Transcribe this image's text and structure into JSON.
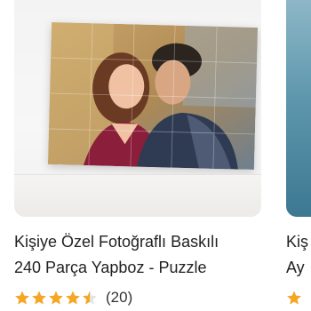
{
  "product": {
    "title_line1": "Kişiye Özel Fotoğraflı Baskılı",
    "title_line2": "240 Parça Yapboz - Puzzle",
    "rating_value": 4.5,
    "rating_max": 5,
    "review_count": "(20)"
  },
  "next_product": {
    "title_line1": "Kiş",
    "title_line2": "Ay"
  },
  "colors": {
    "star": "#f5a623",
    "text": "#222222"
  },
  "icons": {
    "rating": "star-icon"
  }
}
